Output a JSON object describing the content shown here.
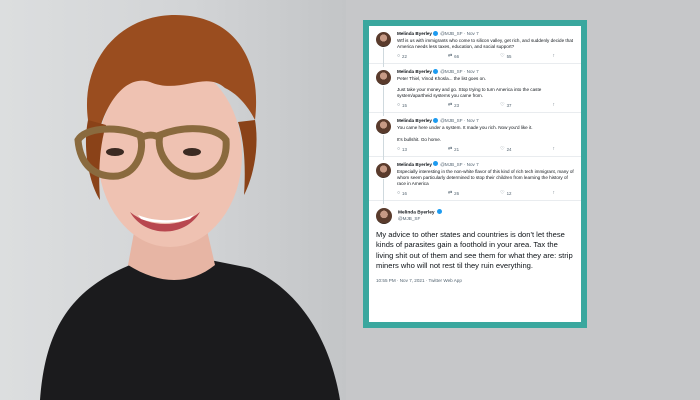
{
  "tweets": [
    {
      "name": "Melinda Byerley",
      "handle": "@MJB_SF",
      "date": "Nov 7",
      "paragraphs": [
        "Wtf is us with immigrants who come to silicon valley, get rich, and suddenly decide that America needs less taxes, education, and social support?"
      ],
      "replies": "22",
      "retweets": "66",
      "likes": "55"
    },
    {
      "name": "Melinda Byerley",
      "handle": "@MJB_SF",
      "date": "Nov 7",
      "paragraphs": [
        "Peter Thiel, Vinod Khosla... the list goes on.",
        "Just take your money and go. Stop trying to turn America into the caste system/apartheid systems you came from."
      ],
      "replies": "15",
      "retweets": "23",
      "likes": "37"
    },
    {
      "name": "Melinda Byerley",
      "handle": "@MJB_SF",
      "date": "Nov 7",
      "paragraphs": [
        "You came here under a system. It made you rich. Now you'd like it.",
        "It's bullshit. Go home."
      ],
      "replies": "13",
      "retweets": "21",
      "likes": "24"
    },
    {
      "name": "Melinda Byerley",
      "handle": "@MJB_SF",
      "date": "Nov 7",
      "paragraphs": [
        "Especially interesting in the non-white flavor of this kind of rich tech immigrant, many of whom seem particularly determined to stop their children from learning the history of race in America"
      ],
      "replies": "16",
      "retweets": "26",
      "likes": "12"
    }
  ],
  "main_tweet": {
    "name": "Melinda Byerley",
    "handle": "@MJB_SF",
    "text": "My advice to other states and countries is don't let these kinds of parasites gain a foothold in your area. Tax the living shit out of them and see them for what they are: strip miners who will not rest til they ruin everything.",
    "timestamp": "10:55 PM · Nov 7, 2021 · Twitter Web App"
  },
  "colors": {
    "frame": "#3aa79e",
    "verified": "#1d9bf0"
  },
  "icons": [
    "reply-icon",
    "retweet-icon",
    "like-icon",
    "share-icon",
    "verified-icon",
    "more-icon"
  ]
}
